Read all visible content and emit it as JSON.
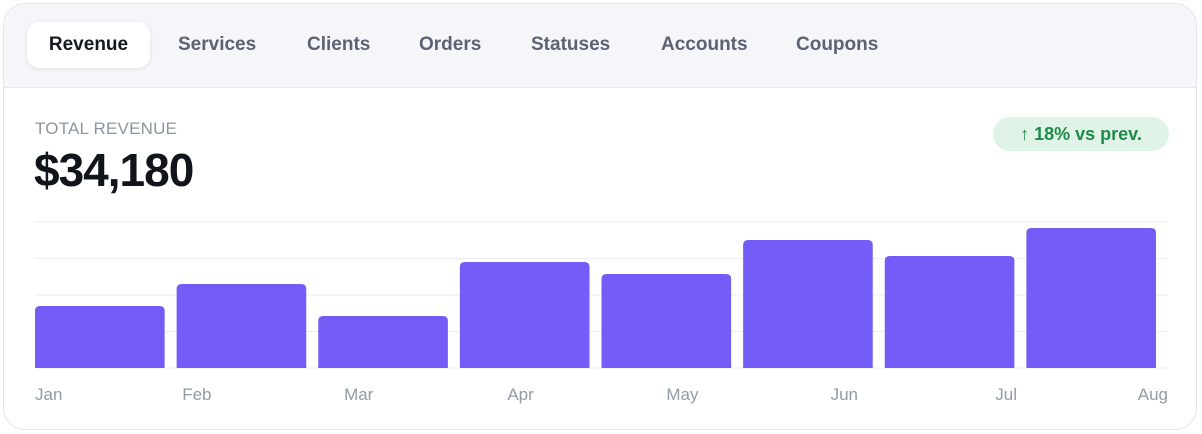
{
  "tabs": [
    {
      "label": "Revenue",
      "active": true
    },
    {
      "label": "Services",
      "active": false
    },
    {
      "label": "Clients",
      "active": false
    },
    {
      "label": "Orders",
      "active": false
    },
    {
      "label": "Statuses",
      "active": false
    },
    {
      "label": "Accounts",
      "active": false
    },
    {
      "label": "Coupons",
      "active": false
    }
  ],
  "summary": {
    "label": "TOTAL REVENUE",
    "value": "$34,180",
    "badge": "↑ 18% vs prev."
  },
  "colors": {
    "bar": "#745cf6",
    "badge_bg": "#dff3e6",
    "badge_text": "#1f8a49",
    "grid": "#eceef3"
  },
  "chart_data": {
    "type": "bar",
    "categories": [
      "Jan",
      "Feb",
      "Mar",
      "Apr",
      "May",
      "Jun",
      "Jul",
      "Aug"
    ],
    "values": [
      62,
      84,
      52,
      106,
      94,
      128,
      112,
      140
    ],
    "ylim": [
      0,
      146
    ],
    "grid": true,
    "xlabel": "",
    "ylabel": ""
  }
}
